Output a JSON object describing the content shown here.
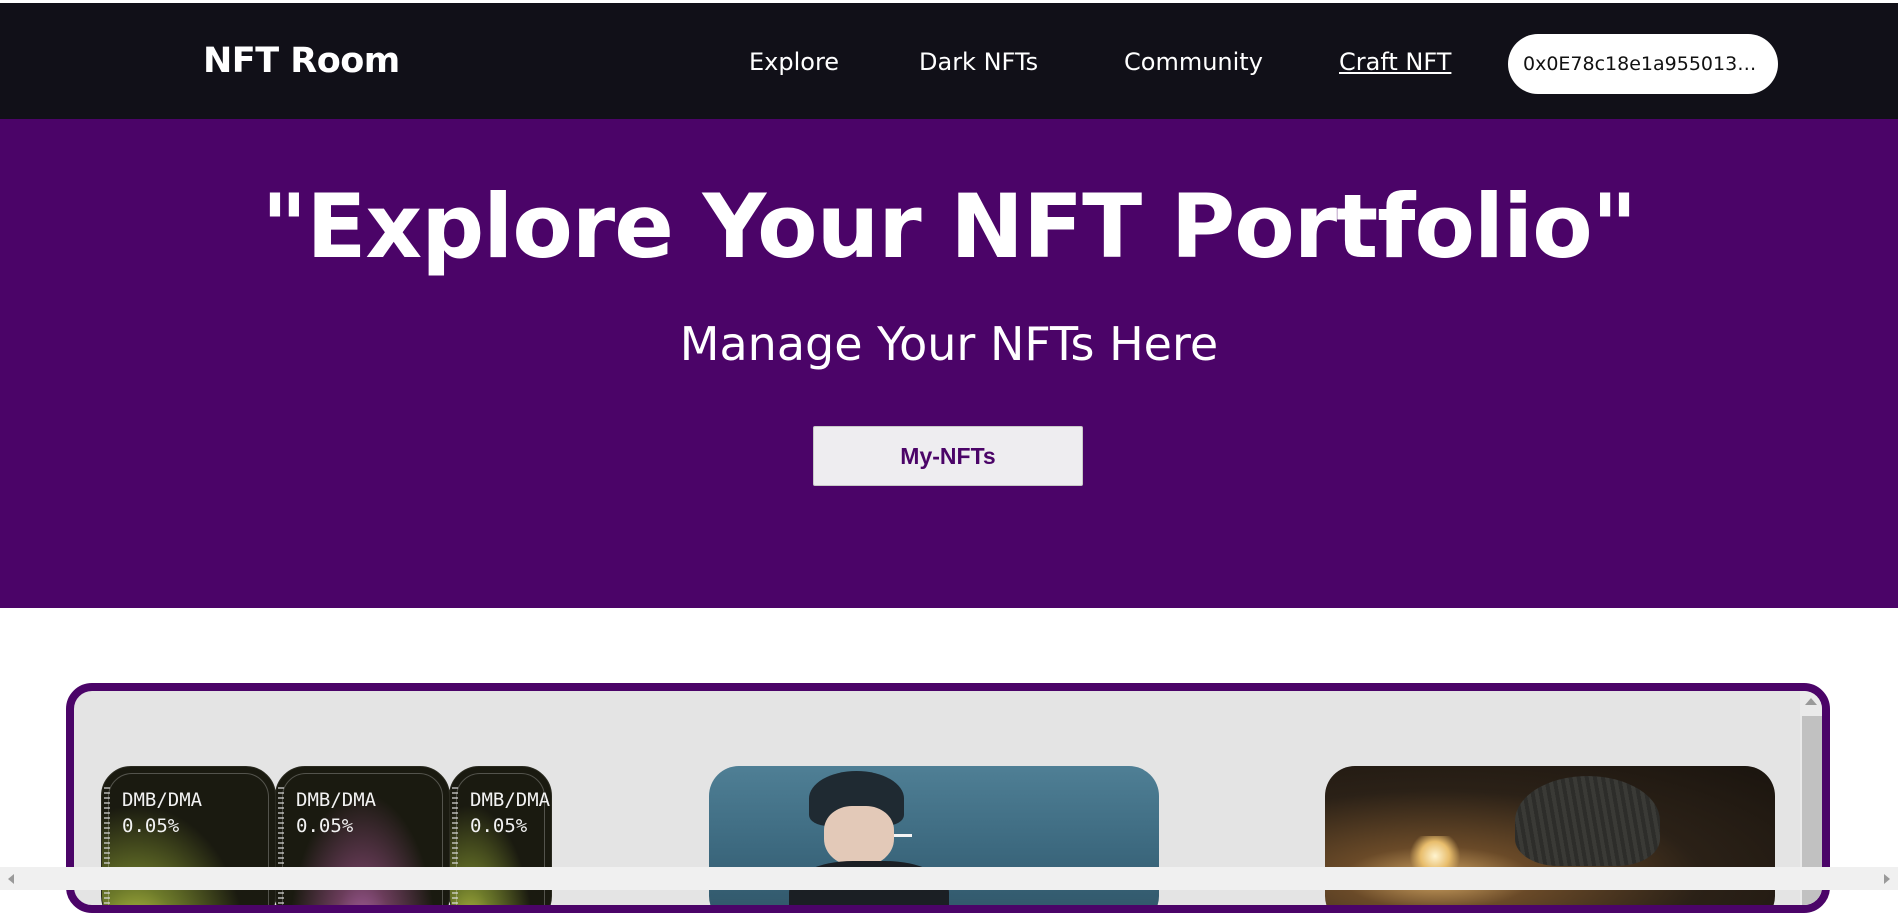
{
  "navbar": {
    "brand": "NFT Room",
    "links": [
      "Explore",
      "Dark NFTs",
      "Community",
      "Craft NFT"
    ],
    "wallet_address": "0x0E78c18e1a9550130D2..."
  },
  "hero": {
    "title": "\"Explore Your NFT Portfolio\"",
    "subtitle": "Manage Your NFTs Here",
    "button_label": "My-NFTs",
    "background_color": "#4b0468"
  },
  "gallery": {
    "token_cards": [
      {
        "pair": "DMB/DMA",
        "percent": "0.05%"
      },
      {
        "pair": "DMB/DMA",
        "percent": "0.05%"
      },
      {
        "pair": "DMB/DMA",
        "percent": "0.05%"
      }
    ],
    "border_color": "#4b0468"
  }
}
